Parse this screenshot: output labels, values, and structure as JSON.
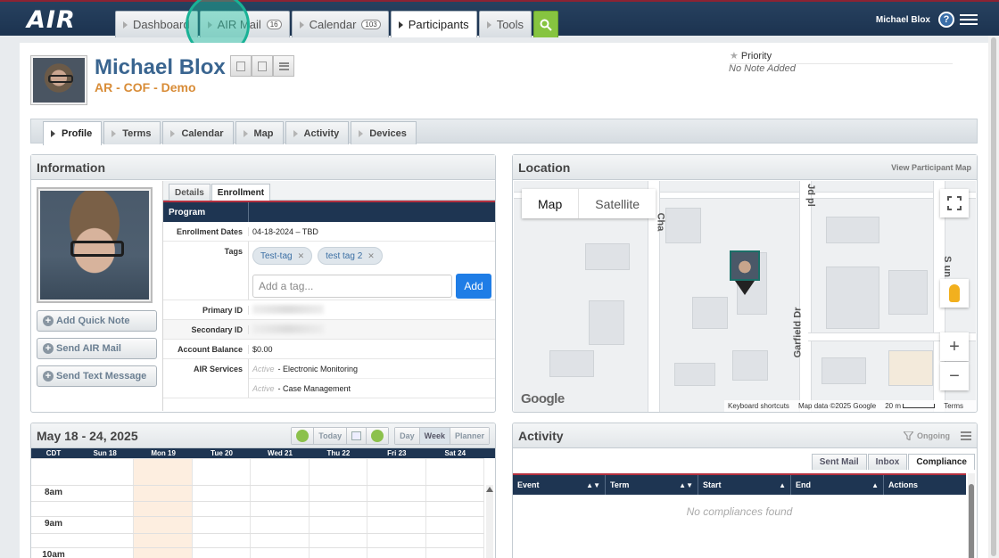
{
  "app": {
    "logo": "AIR",
    "user_name": "Michael Blox"
  },
  "nav": {
    "tabs": [
      {
        "label": "Dashboard"
      },
      {
        "label": "AIR Mail",
        "badge": "16"
      },
      {
        "label": "Calendar",
        "badge": "103"
      },
      {
        "label": "Participants"
      },
      {
        "label": "Tools"
      }
    ],
    "help": "?"
  },
  "participant": {
    "name": "Michael Blox",
    "subtitle": "AR - COF - Demo",
    "priority_label": "Priority",
    "note": "No Note Added"
  },
  "subtabs": [
    "Profile",
    "Terms",
    "Calendar",
    "Map",
    "Activity",
    "Devices"
  ],
  "information": {
    "title": "Information",
    "buttons": [
      "Add Quick Note",
      "Send AIR Mail",
      "Send Text Message"
    ],
    "tabs": [
      "Details",
      "Enrollment"
    ],
    "program_label": "Program",
    "enrollment_dates_label": "Enrollment Dates",
    "enrollment_dates": "04-18-2024 – TBD",
    "tags_label": "Tags",
    "tags": [
      "Test-tag",
      "test tag 2"
    ],
    "tag_placeholder": "Add a tag...",
    "add_label": "Add",
    "primary_id_label": "Primary ID",
    "secondary_id_label": "Secondary ID",
    "balance_label": "Account Balance",
    "balance": "$0.00",
    "services_label": "AIR Services",
    "services": [
      {
        "status": "Active",
        "name": "- Electronic Monitoring"
      },
      {
        "status": "Active",
        "name": "- Case Management"
      }
    ]
  },
  "location": {
    "title": "Location",
    "link": "View Participant Map",
    "map_type": [
      "Map",
      "Satellite"
    ],
    "streets": [
      "Cha",
      "Garfield Dr",
      "Jd pl",
      "S un"
    ],
    "google": "Google",
    "attribution": [
      "Keyboard shortcuts",
      "Map data ©2025 Google",
      "20 m",
      "Terms"
    ]
  },
  "calendar": {
    "title": "May 18 - 24, 2025",
    "today_label": "Today",
    "views": [
      "Day",
      "Week",
      "Planner"
    ],
    "tz": "CDT",
    "days": [
      "Sun 18",
      "Mon 19",
      "Tue 20",
      "Wed 21",
      "Thu 22",
      "Fri 23",
      "Sat 24"
    ],
    "hours": [
      "8am",
      "9am",
      "10am"
    ]
  },
  "activity": {
    "title": "Activity",
    "filter": "Ongoing",
    "tabs": [
      "Sent Mail",
      "Inbox",
      "Compliance"
    ],
    "columns": [
      "Event",
      "Term",
      "Start",
      "End",
      "Actions"
    ],
    "empty": "No compliances found"
  },
  "colors": {
    "navy": "#1e3552",
    "accent_red": "#b4303f",
    "name_blue": "#3a6590",
    "subtitle_orange": "#d88c37",
    "search_green": "#86c440"
  }
}
